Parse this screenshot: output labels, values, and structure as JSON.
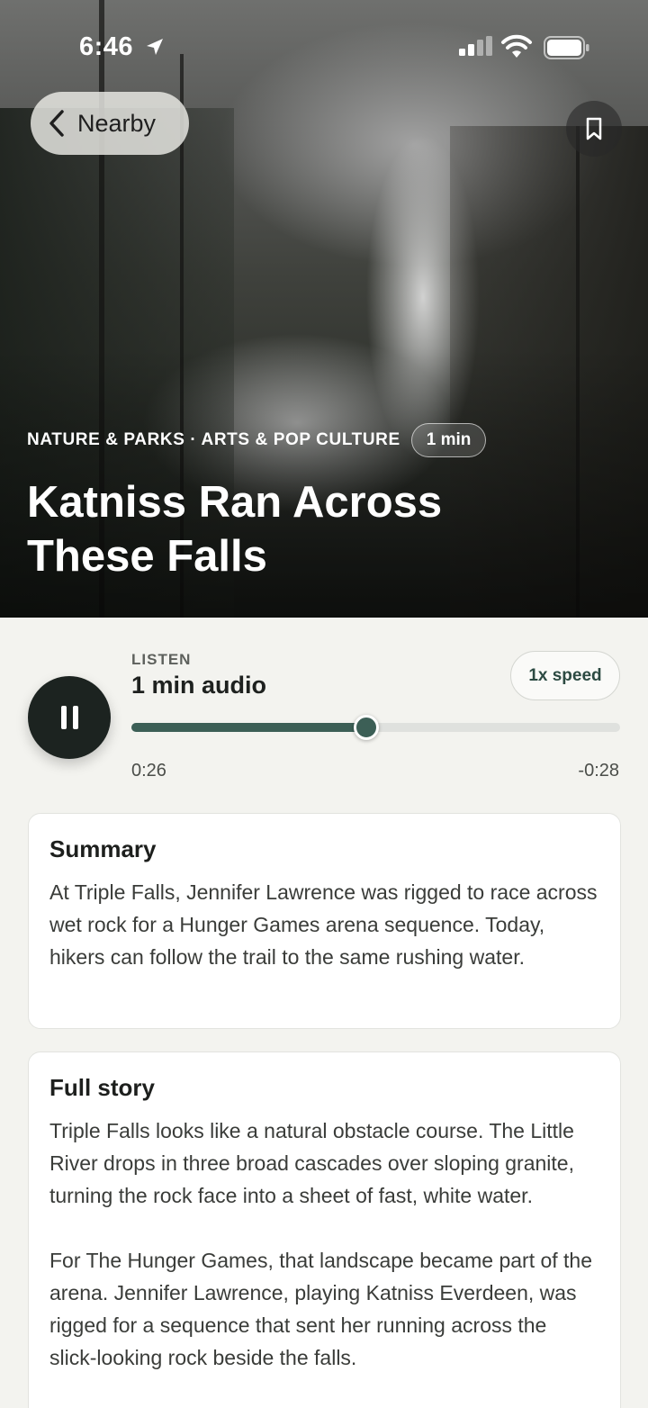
{
  "status_bar": {
    "time": "6:46"
  },
  "nav": {
    "back_label": "Nearby"
  },
  "hero": {
    "categories": "NATURE & PARKS · ARTS & POP CULTURE",
    "duration_badge": "1 min",
    "title": "Katniss Ran Across These Falls"
  },
  "player": {
    "listen_label": "LISTEN",
    "audio_length": "1 min audio",
    "speed_label": "1x speed",
    "elapsed": "0:26",
    "remaining": "-0:28",
    "progress_fraction": 0.48,
    "state": "playing"
  },
  "summary": {
    "heading": "Summary",
    "text": "At Triple Falls, Jennifer Lawrence was rigged to race across wet rock for a Hunger Games arena sequence. Today, hikers can follow the trail to the same rushing water."
  },
  "full_story": {
    "heading": "Full story",
    "paragraphs": [
      "Triple Falls looks like a natural obstacle course. The Little River drops in three broad cascades over sloping granite, turning the rock face into a sheet of fast, white water.",
      "For The Hunger Games, that landscape became part of the arena. Jennifer Lawrence, playing Katniss Everdeen, was rigged for a sequence that sent her running across the slick-looking rock beside the falls."
    ]
  },
  "colors": {
    "accent": "#3c5f56",
    "play_button": "#1c2320",
    "background": "#f3f3ef"
  },
  "icons": {
    "back": "chevron-left-icon",
    "bookmark": "bookmark-icon",
    "pause": "pause-icon"
  }
}
